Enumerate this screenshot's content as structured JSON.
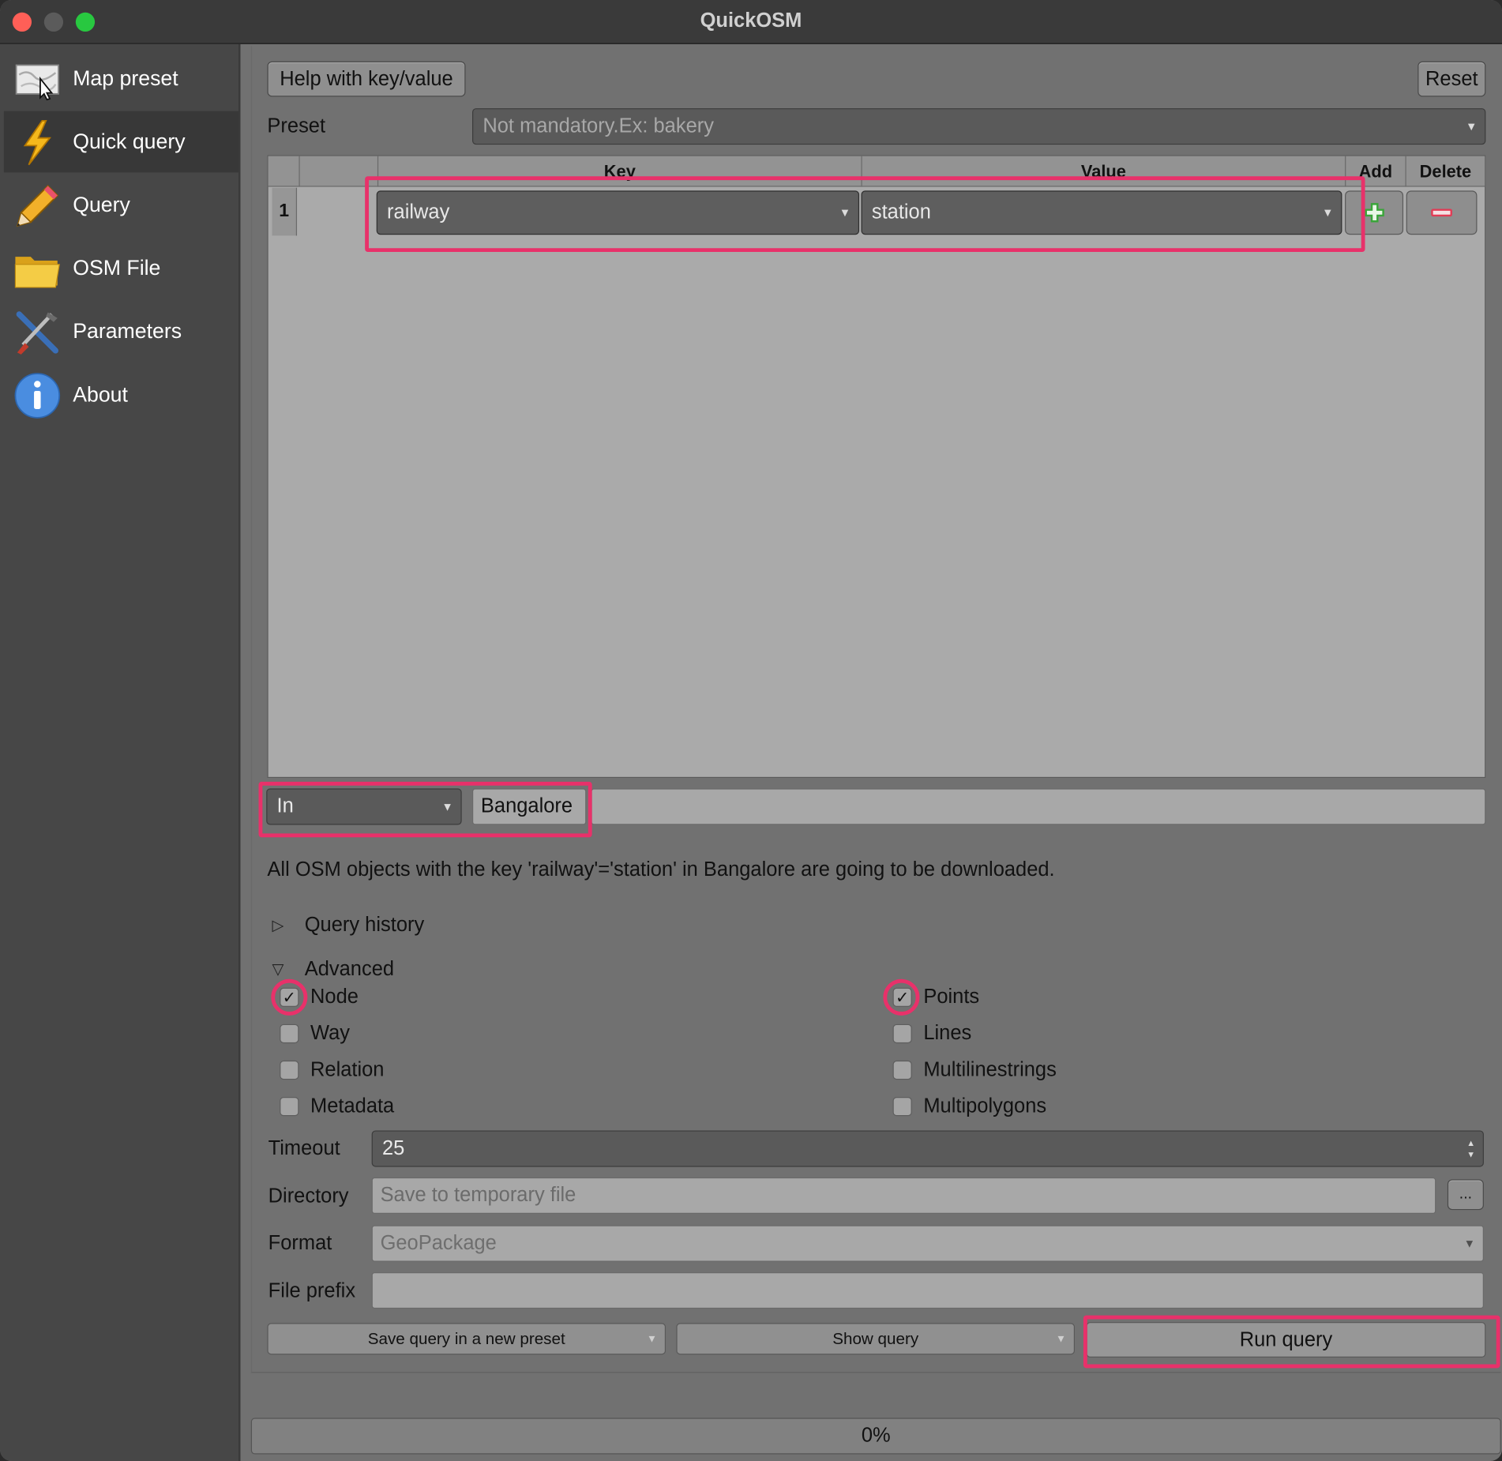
{
  "window": {
    "title": "QuickOSM"
  },
  "sidebar": {
    "items": [
      {
        "label": "Map preset",
        "icon": "map-icon",
        "active": false
      },
      {
        "label": "Quick query",
        "icon": "lightning-icon",
        "active": true
      },
      {
        "label": "Query",
        "icon": "pencil-icon",
        "active": false
      },
      {
        "label": "OSM File",
        "icon": "folder-icon",
        "active": false
      },
      {
        "label": "Parameters",
        "icon": "tools-icon",
        "active": false
      },
      {
        "label": "About",
        "icon": "info-icon",
        "active": false
      }
    ]
  },
  "toolbar": {
    "help_label": "Help with key/value",
    "reset_label": "Reset"
  },
  "preset": {
    "label": "Preset",
    "placeholder": "Not mandatory.Ex: bakery"
  },
  "table": {
    "headers": {
      "key": "Key",
      "value": "Value",
      "add": "Add",
      "delete": "Delete"
    },
    "rows": [
      {
        "num": "1",
        "key": "railway",
        "value": "station"
      }
    ]
  },
  "location": {
    "mode": "In",
    "place": "Bangalore"
  },
  "description": "All OSM objects with the key 'railway'='station' in Bangalore are going to be downloaded.",
  "sections": {
    "history": "Query history",
    "advanced": "Advanced"
  },
  "osm_types": [
    {
      "label": "Node",
      "checked": true
    },
    {
      "label": "Way",
      "checked": false
    },
    {
      "label": "Relation",
      "checked": false
    },
    {
      "label": "Metadata",
      "checked": false
    }
  ],
  "geometries": [
    {
      "label": "Points",
      "checked": true
    },
    {
      "label": "Lines",
      "checked": false
    },
    {
      "label": "Multilinestrings",
      "checked": false
    },
    {
      "label": "Multipolygons",
      "checked": false
    }
  ],
  "fields": {
    "timeout_label": "Timeout",
    "timeout_value": "25",
    "directory_label": "Directory",
    "directory_placeholder": "Save to temporary file",
    "browse_label": "...",
    "format_label": "Format",
    "format_value": "GeoPackage",
    "prefix_label": "File prefix",
    "prefix_value": ""
  },
  "actions": {
    "save_preset": "Save query in a new preset",
    "show_query": "Show query",
    "run": "Run query"
  },
  "progress": {
    "text": "0%",
    "percent": 0
  },
  "colors": {
    "highlight": "#e8316a",
    "accent_green": "#3aa53a",
    "accent_red": "#e23b55"
  }
}
